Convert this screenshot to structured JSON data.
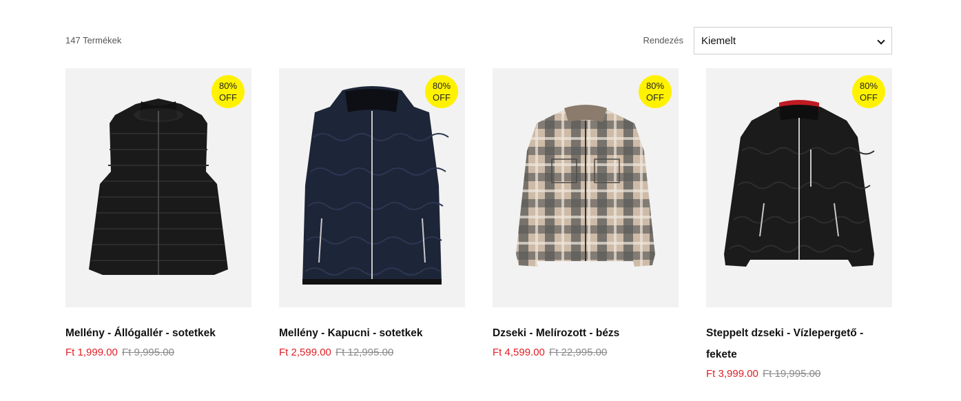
{
  "toolbar": {
    "product_count": "147 Termékek",
    "sort_label": "Rendezés",
    "sort_selected": "Kiemelt"
  },
  "products": [
    {
      "title": "Mellény - Állógallér - sotetkek",
      "badge_line1": "80%",
      "badge_line2": "OFF",
      "price_now": "Ft 1,999.00",
      "price_was": "Ft 9,995.00",
      "image": "black-puffer-vest"
    },
    {
      "title": "Mellény - Kapucni - sotetkek",
      "badge_line1": "80%",
      "badge_line2": "OFF",
      "price_now": "Ft 2,599.00",
      "price_was": "Ft 12,995.00",
      "image": "navy-hooded-quilted-vest"
    },
    {
      "title": "Dzseki - Melírozott - bézs",
      "badge_line1": "80%",
      "badge_line2": "OFF",
      "price_now": "Ft 4,599.00",
      "price_was": "Ft 22,995.00",
      "image": "beige-plaid-overshirt-jacket"
    },
    {
      "title": "Steppelt dzseki - Vízlepergető - fekete",
      "badge_line1": "80%",
      "badge_line2": "OFF",
      "price_now": "Ft 3,999.00",
      "price_was": "Ft 19,995.00",
      "image": "black-quilted-jacket"
    }
  ],
  "colors": {
    "sale_price": "#e01e24",
    "badge": "#fff200",
    "thumb_bg": "#f2f2f2"
  }
}
